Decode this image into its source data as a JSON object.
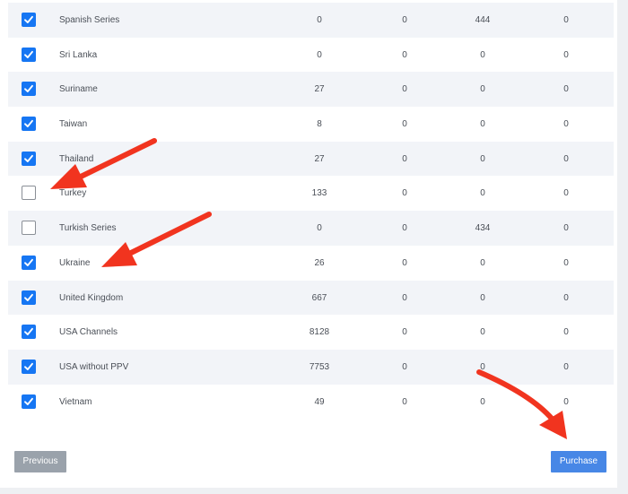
{
  "table": {
    "rows": [
      {
        "name": "Spanish Series",
        "checked": true,
        "c1": "0",
        "c2": "0",
        "c3": "444",
        "c4": "0"
      },
      {
        "name": "Sri Lanka",
        "checked": true,
        "c1": "0",
        "c2": "0",
        "c3": "0",
        "c4": "0"
      },
      {
        "name": "Suriname",
        "checked": true,
        "c1": "27",
        "c2": "0",
        "c3": "0",
        "c4": "0"
      },
      {
        "name": "Taiwan",
        "checked": true,
        "c1": "8",
        "c2": "0",
        "c3": "0",
        "c4": "0"
      },
      {
        "name": "Thailand",
        "checked": true,
        "c1": "27",
        "c2": "0",
        "c3": "0",
        "c4": "0"
      },
      {
        "name": "Turkey",
        "checked": false,
        "c1": "133",
        "c2": "0",
        "c3": "0",
        "c4": "0"
      },
      {
        "name": "Turkish Series",
        "checked": false,
        "c1": "0",
        "c2": "0",
        "c3": "434",
        "c4": "0"
      },
      {
        "name": "Ukraine",
        "checked": true,
        "c1": "26",
        "c2": "0",
        "c3": "0",
        "c4": "0"
      },
      {
        "name": "United Kingdom",
        "checked": true,
        "c1": "667",
        "c2": "0",
        "c3": "0",
        "c4": "0"
      },
      {
        "name": "USA Channels",
        "checked": true,
        "c1": "8128",
        "c2": "0",
        "c3": "0",
        "c4": "0"
      },
      {
        "name": "USA without PPV",
        "checked": true,
        "c1": "7753",
        "c2": "0",
        "c3": "0",
        "c4": "0"
      },
      {
        "name": "Vietnam",
        "checked": true,
        "c1": "49",
        "c2": "0",
        "c3": "0",
        "c4": "0"
      }
    ]
  },
  "buttons": {
    "previous": "Previous",
    "purchase": "Purchase"
  },
  "colors": {
    "checkbox_checked": "#1676f3",
    "purchase_button": "#4787e6",
    "previous_button": "#9aa2ab",
    "annotation_arrow": "#f1341f"
  }
}
